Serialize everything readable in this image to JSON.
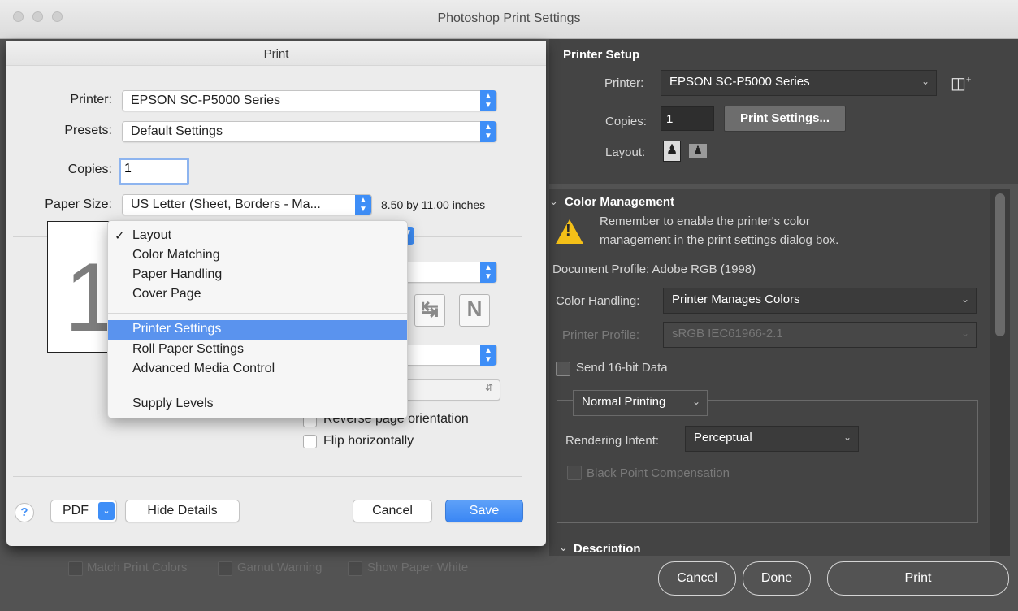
{
  "window": {
    "title": "Photoshop Print Settings"
  },
  "printer_setup": {
    "header": "Printer Setup",
    "printer_label": "Printer:",
    "printer_value": "EPSON SC-P5000 Series",
    "copies_label": "Copies:",
    "copies_value": "1",
    "print_settings_button": "Print Settings...",
    "layout_label": "Layout:"
  },
  "color_management": {
    "header": "Color Management",
    "warning_line1": "Remember to enable the printer's color",
    "warning_line2": "management in the print settings dialog box.",
    "document_profile": "Document Profile: Adobe RGB (1998)",
    "color_handling_label": "Color Handling:",
    "color_handling_value": "Printer Manages Colors",
    "printer_profile_label": "Printer Profile:",
    "printer_profile_value": "sRGB IEC61966-2.1",
    "send_16bit_label": "Send 16-bit Data",
    "normal_printing": "Normal Printing",
    "rendering_intent_label": "Rendering Intent:",
    "rendering_intent_value": "Perceptual",
    "black_point_label": "Black Point Compensation",
    "description_header": "Description"
  },
  "bottom": {
    "match_print_colors": "Match Print Colors",
    "gamut_warning": "Gamut Warning",
    "show_paper_white": "Show Paper White",
    "cancel": "Cancel",
    "done": "Done",
    "print": "Print"
  },
  "print_dialog": {
    "title": "Print",
    "printer_label": "Printer:",
    "printer_value": "EPSON SC-P5000 Series",
    "presets_label": "Presets:",
    "presets_value": "Default Settings",
    "copies_label": "Copies:",
    "copies_value": "1",
    "paper_size_label": "Paper Size:",
    "paper_size_value": "US Letter (Sheet, Borders - Ma...",
    "paper_dimensions": "8.50 by 11.00 inches",
    "reverse_orientation": "Reverse page orientation",
    "flip_horizontally": "Flip horizontally",
    "help": "?",
    "pdf": "PDF",
    "hide_details": "Hide Details",
    "cancel": "Cancel",
    "save": "Save",
    "preview_page_number": "1"
  },
  "menu": {
    "items": [
      {
        "label": "Layout",
        "checked": "✓"
      },
      {
        "label": "Color Matching"
      },
      {
        "label": "Paper Handling"
      },
      {
        "label": "Cover Page"
      },
      {
        "label": "Printer Settings"
      },
      {
        "label": "Roll Paper Settings"
      },
      {
        "label": "Advanced Media Control"
      },
      {
        "label": "Supply Levels"
      }
    ]
  }
}
